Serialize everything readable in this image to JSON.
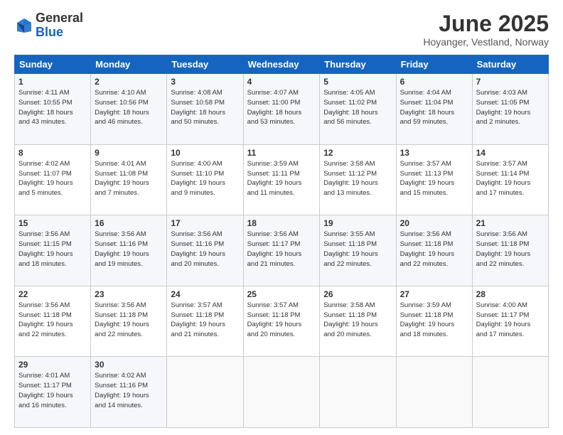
{
  "header": {
    "logo_general": "General",
    "logo_blue": "Blue",
    "month_title": "June 2025",
    "location": "Hoyanger, Vestland, Norway"
  },
  "calendar": {
    "headers": [
      "Sunday",
      "Monday",
      "Tuesday",
      "Wednesday",
      "Thursday",
      "Friday",
      "Saturday"
    ],
    "rows": [
      [
        {
          "day": "1",
          "info": "Sunrise: 4:11 AM\nSunset: 10:55 PM\nDaylight: 18 hours\nand 43 minutes."
        },
        {
          "day": "2",
          "info": "Sunrise: 4:10 AM\nSunset: 10:56 PM\nDaylight: 18 hours\nand 46 minutes."
        },
        {
          "day": "3",
          "info": "Sunrise: 4:08 AM\nSunset: 10:58 PM\nDaylight: 18 hours\nand 50 minutes."
        },
        {
          "day": "4",
          "info": "Sunrise: 4:07 AM\nSunset: 11:00 PM\nDaylight: 18 hours\nand 53 minutes."
        },
        {
          "day": "5",
          "info": "Sunrise: 4:05 AM\nSunset: 11:02 PM\nDaylight: 18 hours\nand 56 minutes."
        },
        {
          "day": "6",
          "info": "Sunrise: 4:04 AM\nSunset: 11:04 PM\nDaylight: 18 hours\nand 59 minutes."
        },
        {
          "day": "7",
          "info": "Sunrise: 4:03 AM\nSunset: 11:05 PM\nDaylight: 19 hours\nand 2 minutes."
        }
      ],
      [
        {
          "day": "8",
          "info": "Sunrise: 4:02 AM\nSunset: 11:07 PM\nDaylight: 19 hours\nand 5 minutes."
        },
        {
          "day": "9",
          "info": "Sunrise: 4:01 AM\nSunset: 11:08 PM\nDaylight: 19 hours\nand 7 minutes."
        },
        {
          "day": "10",
          "info": "Sunrise: 4:00 AM\nSunset: 11:10 PM\nDaylight: 19 hours\nand 9 minutes."
        },
        {
          "day": "11",
          "info": "Sunrise: 3:59 AM\nSunset: 11:11 PM\nDaylight: 19 hours\nand 11 minutes."
        },
        {
          "day": "12",
          "info": "Sunrise: 3:58 AM\nSunset: 11:12 PM\nDaylight: 19 hours\nand 13 minutes."
        },
        {
          "day": "13",
          "info": "Sunrise: 3:57 AM\nSunset: 11:13 PM\nDaylight: 19 hours\nand 15 minutes."
        },
        {
          "day": "14",
          "info": "Sunrise: 3:57 AM\nSunset: 11:14 PM\nDaylight: 19 hours\nand 17 minutes."
        }
      ],
      [
        {
          "day": "15",
          "info": "Sunrise: 3:56 AM\nSunset: 11:15 PM\nDaylight: 19 hours\nand 18 minutes."
        },
        {
          "day": "16",
          "info": "Sunrise: 3:56 AM\nSunset: 11:16 PM\nDaylight: 19 hours\nand 19 minutes."
        },
        {
          "day": "17",
          "info": "Sunrise: 3:56 AM\nSunset: 11:16 PM\nDaylight: 19 hours\nand 20 minutes."
        },
        {
          "day": "18",
          "info": "Sunrise: 3:56 AM\nSunset: 11:17 PM\nDaylight: 19 hours\nand 21 minutes."
        },
        {
          "day": "19",
          "info": "Sunrise: 3:55 AM\nSunset: 11:18 PM\nDaylight: 19 hours\nand 22 minutes."
        },
        {
          "day": "20",
          "info": "Sunrise: 3:56 AM\nSunset: 11:18 PM\nDaylight: 19 hours\nand 22 minutes."
        },
        {
          "day": "21",
          "info": "Sunrise: 3:56 AM\nSunset: 11:18 PM\nDaylight: 19 hours\nand 22 minutes."
        }
      ],
      [
        {
          "day": "22",
          "info": "Sunrise: 3:56 AM\nSunset: 11:18 PM\nDaylight: 19 hours\nand 22 minutes."
        },
        {
          "day": "23",
          "info": "Sunrise: 3:56 AM\nSunset: 11:18 PM\nDaylight: 19 hours\nand 22 minutes."
        },
        {
          "day": "24",
          "info": "Sunrise: 3:57 AM\nSunset: 11:18 PM\nDaylight: 19 hours\nand 21 minutes."
        },
        {
          "day": "25",
          "info": "Sunrise: 3:57 AM\nSunset: 11:18 PM\nDaylight: 19 hours\nand 20 minutes."
        },
        {
          "day": "26",
          "info": "Sunrise: 3:58 AM\nSunset: 11:18 PM\nDaylight: 19 hours\nand 20 minutes."
        },
        {
          "day": "27",
          "info": "Sunrise: 3:59 AM\nSunset: 11:18 PM\nDaylight: 19 hours\nand 18 minutes."
        },
        {
          "day": "28",
          "info": "Sunrise: 4:00 AM\nSunset: 11:17 PM\nDaylight: 19 hours\nand 17 minutes."
        }
      ],
      [
        {
          "day": "29",
          "info": "Sunrise: 4:01 AM\nSunset: 11:17 PM\nDaylight: 19 hours\nand 16 minutes."
        },
        {
          "day": "30",
          "info": "Sunrise: 4:02 AM\nSunset: 11:16 PM\nDaylight: 19 hours\nand 14 minutes."
        },
        {
          "day": "",
          "info": ""
        },
        {
          "day": "",
          "info": ""
        },
        {
          "day": "",
          "info": ""
        },
        {
          "day": "",
          "info": ""
        },
        {
          "day": "",
          "info": ""
        }
      ]
    ]
  }
}
